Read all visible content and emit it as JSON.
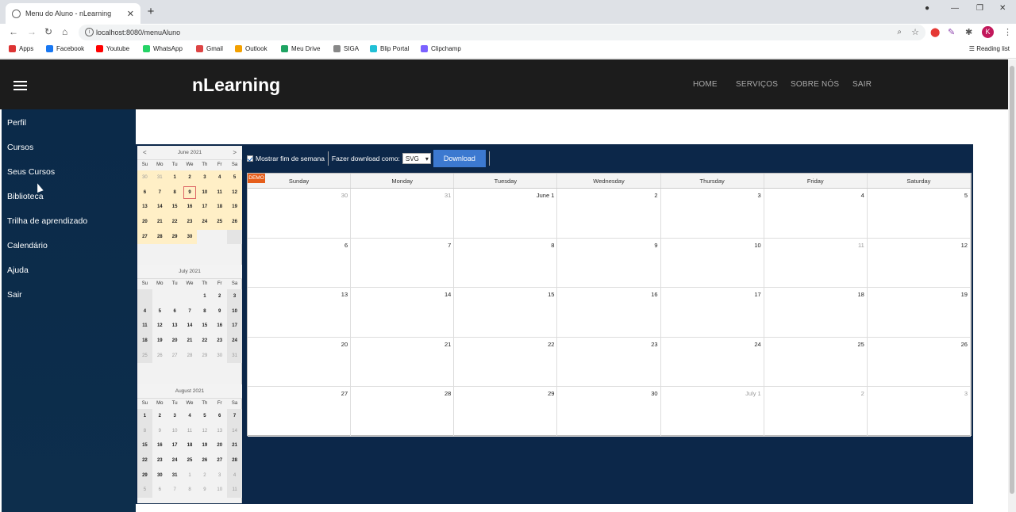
{
  "browser": {
    "tab_title": "Menu do Aluno - nLearning",
    "url": "localhost:8080/menuAluno",
    "profile_initial": "K",
    "bookmarks": [
      {
        "label": "Apps",
        "color": "#d33"
      },
      {
        "label": "Facebook",
        "color": "#1877f2"
      },
      {
        "label": "Youtube",
        "color": "#f00"
      },
      {
        "label": "WhatsApp",
        "color": "#25d366"
      },
      {
        "label": "Gmail",
        "color": "#d44"
      },
      {
        "label": "Outlook",
        "color": "#f3a000"
      },
      {
        "label": "Meu Drive",
        "color": "#1fa463"
      },
      {
        "label": "SIGA",
        "color": "#888"
      },
      {
        "label": "Blip Portal",
        "color": "#21c0d6"
      },
      {
        "label": "Clipchamp",
        "color": "#7b61ff"
      }
    ],
    "reading_list": "Reading list"
  },
  "app": {
    "brand": "nLearning",
    "nav": [
      "HOME",
      "SERVIÇOS",
      "SOBRE NÓS",
      "SAIR"
    ],
    "sidebar": [
      "Perfil",
      "Cursos",
      "Seus Cursos",
      "Biblioteca",
      "Trilha de aprendizado",
      "Calendário",
      "Ajuda",
      "Sair"
    ]
  },
  "navigator": {
    "dow": [
      "Su",
      "Mo",
      "Tu",
      "We",
      "Th",
      "Fr",
      "Sa"
    ],
    "months": [
      {
        "title": "June 2021",
        "weeks": [
          [
            "30",
            "31",
            "1",
            "2",
            "3",
            "4",
            "5"
          ],
          [
            "6",
            "7",
            "8",
            "9",
            "10",
            "11",
            "12"
          ],
          [
            "13",
            "14",
            "15",
            "16",
            "17",
            "18",
            "19"
          ],
          [
            "20",
            "21",
            "22",
            "23",
            "24",
            "25",
            "26"
          ],
          [
            "27",
            "28",
            "29",
            "30",
            "",
            "",
            " "
          ]
        ]
      },
      {
        "title": "July 2021",
        "weeks": [
          [
            "",
            "",
            "",
            "",
            "1",
            "2",
            "3"
          ],
          [
            "4",
            "5",
            "6",
            "7",
            "8",
            "9",
            "10"
          ],
          [
            "11",
            "12",
            "13",
            "14",
            "15",
            "16",
            "17"
          ],
          [
            "18",
            "19",
            "20",
            "21",
            "22",
            "23",
            "24"
          ],
          [
            "25",
            "26",
            "27",
            "28",
            "29",
            "30",
            "31"
          ]
        ]
      },
      {
        "title": "August 2021",
        "weeks": [
          [
            "1",
            "2",
            "3",
            "4",
            "5",
            "6",
            "7"
          ],
          [
            "8",
            "9",
            "10",
            "11",
            "12",
            "13",
            "14"
          ],
          [
            "15",
            "16",
            "17",
            "18",
            "19",
            "20",
            "21"
          ],
          [
            "22",
            "23",
            "24",
            "25",
            "26",
            "27",
            "28"
          ],
          [
            "29",
            "30",
            "31",
            "1",
            "2",
            "3",
            "4"
          ],
          [
            "5",
            "6",
            "7",
            "8",
            "9",
            "10",
            "11"
          ]
        ]
      }
    ]
  },
  "controls": {
    "show_weekend": "Mostrar fim de semana",
    "download_as": "Fazer download como:",
    "format": "SVG",
    "download": "Download"
  },
  "month_view": {
    "demo": "DEMO",
    "dow": [
      "Sunday",
      "Monday",
      "Tuesday",
      "Wednesday",
      "Thursday",
      "Friday",
      "Saturday"
    ],
    "weeks": [
      [
        "30",
        "31",
        "June 1",
        "2",
        "3",
        "4",
        "5"
      ],
      [
        "6",
        "7",
        "8",
        "9",
        "10",
        "11",
        "12"
      ],
      [
        "13",
        "14",
        "15",
        "16",
        "17",
        "18",
        "19"
      ],
      [
        "20",
        "21",
        "22",
        "23",
        "24",
        "25",
        "26"
      ],
      [
        "27",
        "28",
        "29",
        "30",
        "July 1",
        "2",
        "3"
      ]
    ]
  }
}
